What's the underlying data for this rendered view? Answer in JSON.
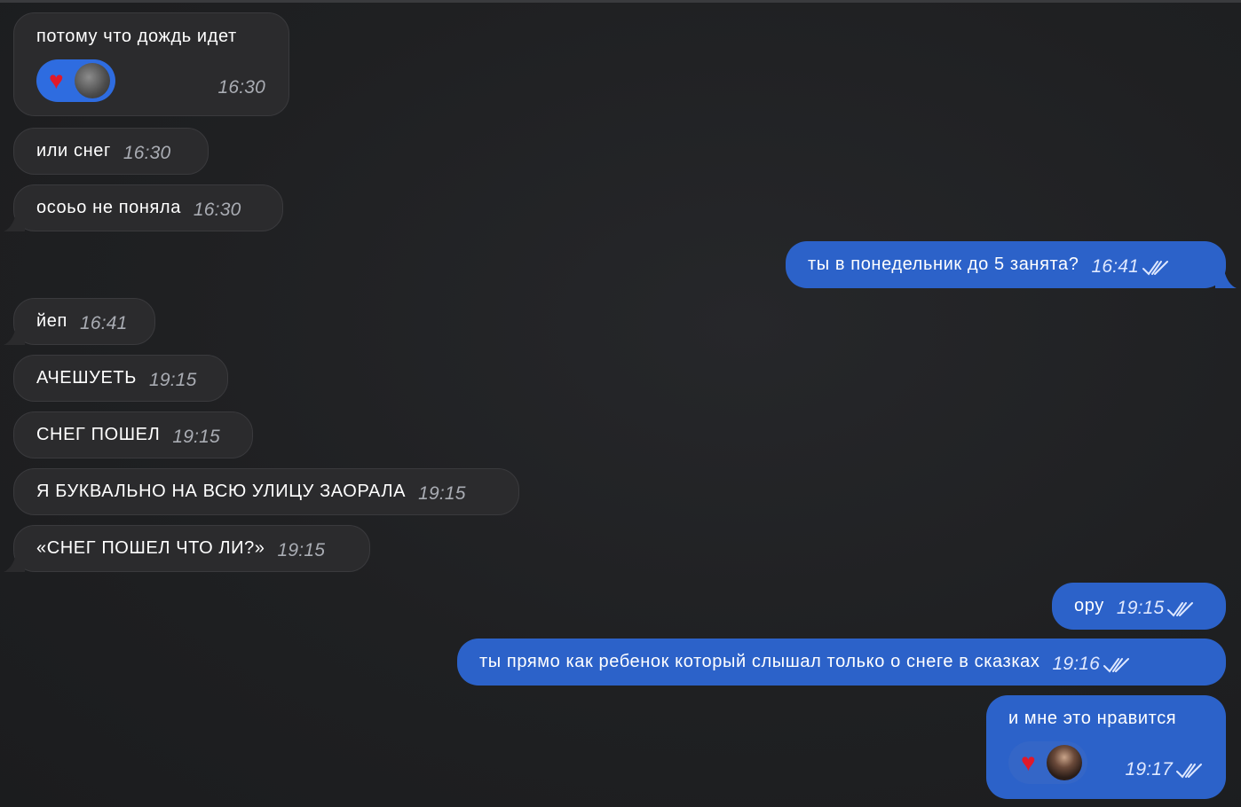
{
  "messages": [
    {
      "dir": "in",
      "text": "потому что дождь идет",
      "time": "16:30",
      "reaction": "heart",
      "reaction_avatar": "grey-avatar"
    },
    {
      "dir": "in",
      "text": "или снег",
      "time": "16:30"
    },
    {
      "dir": "in",
      "text": "осоьо не поняла",
      "time": "16:30"
    },
    {
      "dir": "out",
      "text": "ты в понедельник до 5 занята?",
      "time": "16:41",
      "status": "read"
    },
    {
      "dir": "in",
      "text": "йеп",
      "time": "16:41"
    },
    {
      "dir": "in",
      "text": "АЧЕШУЕТЬ",
      "time": "19:15"
    },
    {
      "dir": "in",
      "text": "СНЕГ ПОШЕЛ",
      "time": "19:15"
    },
    {
      "dir": "in",
      "text": "Я БУКВАЛЬНО НА ВСЮ УЛИЦУ ЗАОРАЛА",
      "time": "19:15"
    },
    {
      "dir": "in",
      "text": "«СНЕГ ПОШЕЛ ЧТО ЛИ?»",
      "time": "19:15"
    },
    {
      "dir": "out",
      "text": "ору",
      "time": "19:15",
      "status": "read"
    },
    {
      "dir": "out",
      "text": "ты прямо как ребенок который слышал только о снеге в сказках",
      "time": "19:16",
      "status": "read"
    },
    {
      "dir": "out",
      "text": "и мне это нравится",
      "time": "19:17",
      "status": "read",
      "reaction": "heart",
      "reaction_avatar": "user-avatar"
    }
  ],
  "reaction_glyph": "♥",
  "colors": {
    "background": "#1f2022",
    "incoming_bubble": "#2b2b2d",
    "outgoing_bubble": "#2c62c9",
    "heart": "#e0192a"
  }
}
